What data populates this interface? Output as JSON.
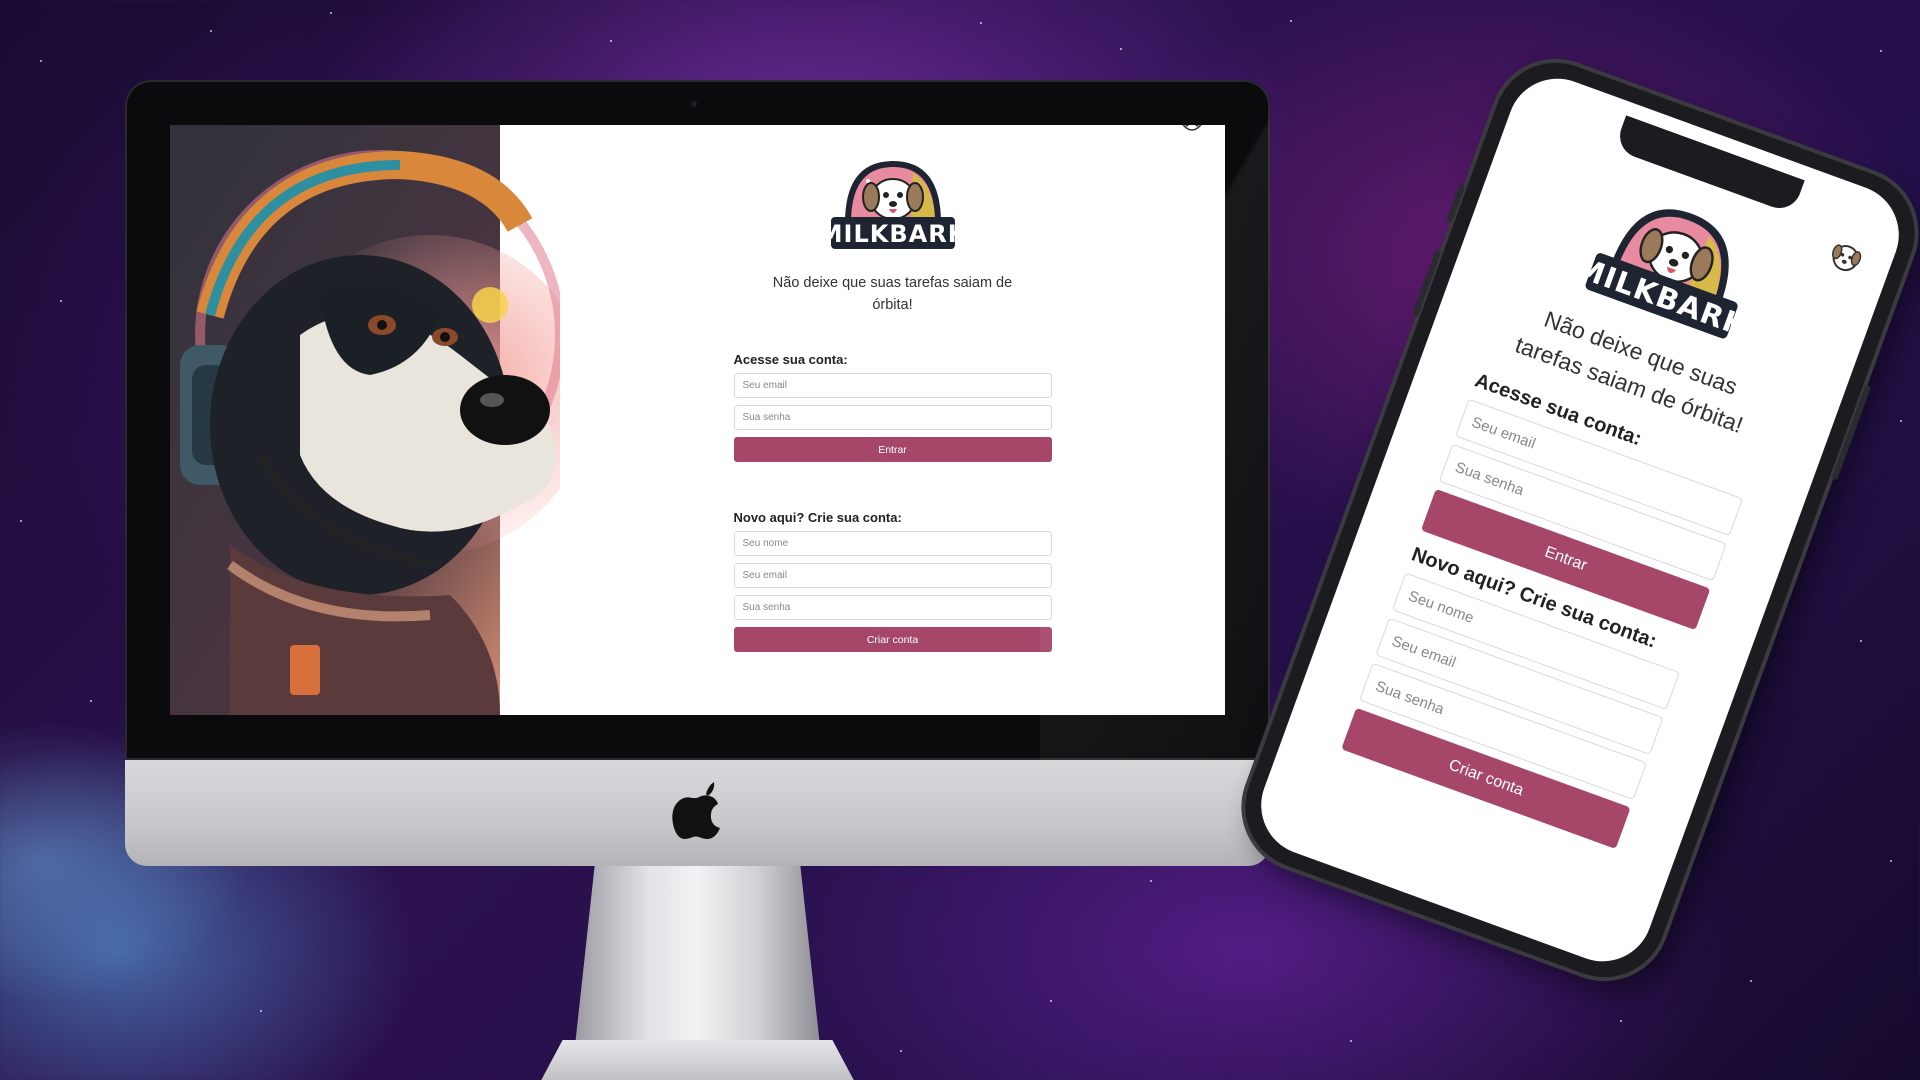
{
  "app": {
    "logo_text": "MILKBARK",
    "tagline": "Não deixe que suas tarefas saiam de órbita!",
    "brand_color": "#a6476a"
  },
  "login": {
    "title": "Acesse sua conta:",
    "email_placeholder": "Seu email",
    "password_placeholder": "Sua senha",
    "submit_label": "Entrar"
  },
  "signup": {
    "title": "Novo aqui? Crie sua conta:",
    "name_placeholder": "Seu nome",
    "email_placeholder": "Seu email",
    "password_placeholder": "Sua senha",
    "submit_label": "Criar conta"
  },
  "icons": {
    "hero": "astronaut-dog-illustration",
    "logo": "milkbark-dog-logo",
    "corner": "dog-face-icon",
    "device": "apple-logo-icon"
  }
}
